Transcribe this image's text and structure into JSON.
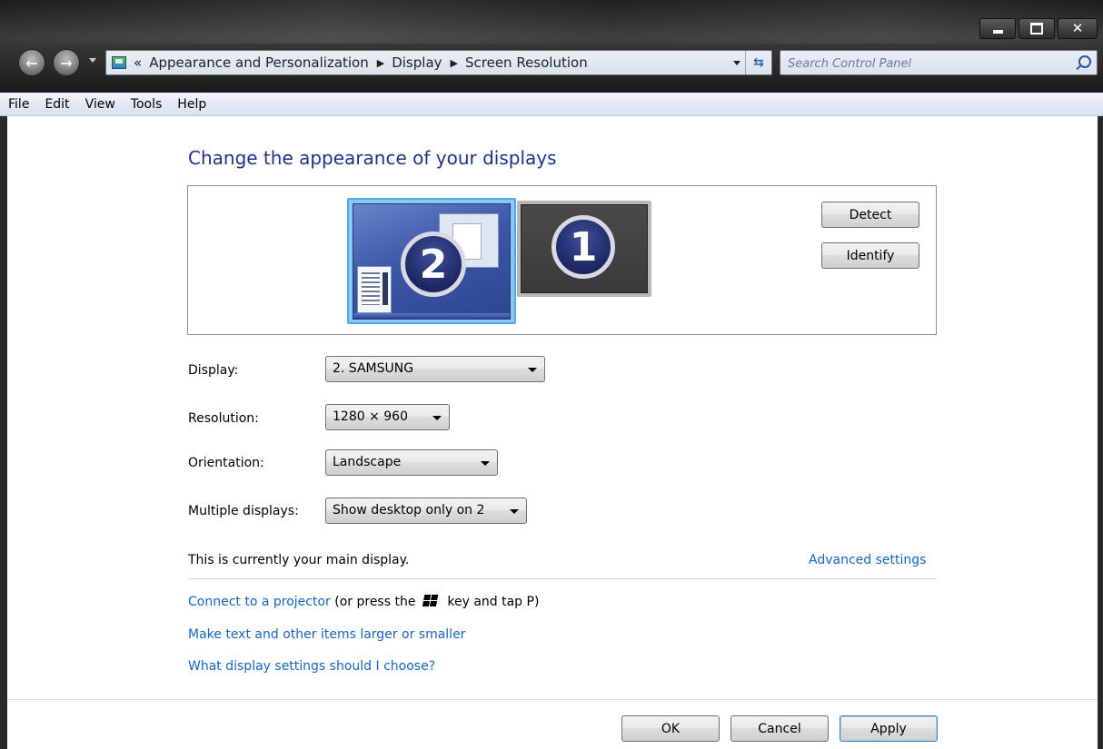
{
  "window": {
    "caption_buttons": [
      "minimize",
      "maximize",
      "close"
    ]
  },
  "navigation": {
    "back_icon": "back-arrow-icon",
    "forward_icon": "forward-arrow-icon"
  },
  "address_bar": {
    "overflow": "«",
    "breadcrumbs": [
      "Appearance and Personalization",
      "Display",
      "Screen Resolution"
    ]
  },
  "search": {
    "placeholder": "Search Control Panel"
  },
  "menu": {
    "items": [
      "File",
      "Edit",
      "View",
      "Tools",
      "Help"
    ]
  },
  "page": {
    "heading": "Change the appearance of your displays"
  },
  "monitors": {
    "selected": "2",
    "items": [
      {
        "number": "2",
        "selected": true
      },
      {
        "number": "1",
        "selected": false
      }
    ],
    "detect_label": "Detect",
    "identify_label": "Identify"
  },
  "settings": {
    "display": {
      "label": "Display:",
      "value": "2. SAMSUNG"
    },
    "resolution": {
      "label": "Resolution:",
      "value": "1280 × 960"
    },
    "orientation": {
      "label": "Orientation:",
      "value": "Landscape"
    },
    "multiple_displays": {
      "label": "Multiple displays:",
      "value": "Show desktop only on 2"
    }
  },
  "status": {
    "main_display_text": "This is currently your main display.",
    "advanced_link": "Advanced settings"
  },
  "links": {
    "projector_link": "Connect to a projector",
    "projector_hint_before": "(or press the",
    "projector_hint_after": "key and tap P)",
    "text_size_link": "Make text and other items larger or smaller",
    "display_help_link": "What display settings should I choose?"
  },
  "footer": {
    "ok_label": "OK",
    "cancel_label": "Cancel",
    "apply_label": "Apply"
  },
  "colors": {
    "heading": "#1e3287",
    "link": "#1566c0",
    "selection": "#52a8ea"
  }
}
